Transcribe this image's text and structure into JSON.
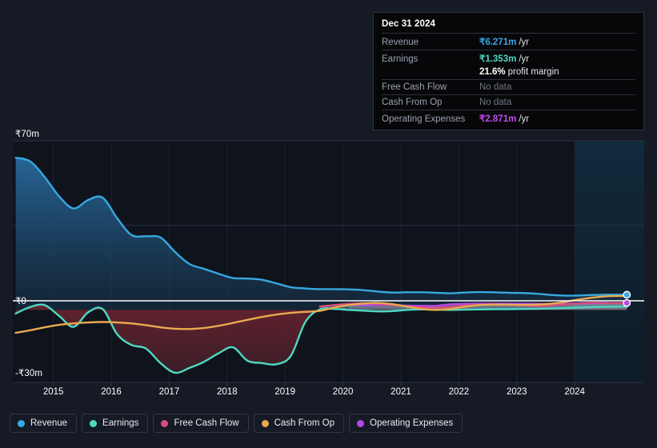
{
  "chart_data": {
    "type": "area",
    "title": "",
    "xlabel": "",
    "ylabel": "",
    "currency_symbol": "₹",
    "grid": true,
    "legend_position": "bottom-left",
    "ylim": [
      -30,
      70
    ],
    "y_ticks": [
      {
        "value": 70,
        "label": "₹70m"
      },
      {
        "value": 0,
        "label": "₹0"
      },
      {
        "value": -30,
        "label": "-₹30m"
      }
    ],
    "y_gridlines": [
      70,
      35,
      0,
      -30
    ],
    "x_ticks": [
      "2015",
      "2016",
      "2017",
      "2018",
      "2019",
      "2020",
      "2021",
      "2022",
      "2023",
      "2024"
    ],
    "xlim": [
      2014.3,
      2025.2
    ],
    "forecast_band_start": 2024.0,
    "series": [
      {
        "name": "Revenue",
        "color": "#38a8e0",
        "x": [
          2014.35,
          2014.6,
          2014.85,
          2015.1,
          2015.35,
          2015.6,
          2015.85,
          2016.1,
          2016.35,
          2016.6,
          2016.85,
          2017.1,
          2017.35,
          2017.6,
          2017.85,
          2018.1,
          2018.35,
          2018.6,
          2018.85,
          2019.1,
          2019.35,
          2019.6,
          2019.85,
          2020.1,
          2020.35,
          2020.6,
          2020.85,
          2021.1,
          2021.35,
          2021.6,
          2021.85,
          2022.1,
          2022.35,
          2022.6,
          2022.85,
          2023.1,
          2023.35,
          2023.6,
          2023.85,
          2024.1,
          2024.35,
          2024.6,
          2024.9
        ],
        "values": [
          63.0,
          61.5,
          55.0,
          47.0,
          42.0,
          45.5,
          46.5,
          38.0,
          31.0,
          30.5,
          30.0,
          24.0,
          19.0,
          17.0,
          15.0,
          13.2,
          13.0,
          12.5,
          11.0,
          9.4,
          8.9,
          8.6,
          8.6,
          8.5,
          8.2,
          7.6,
          7.2,
          7.3,
          7.3,
          7.1,
          6.9,
          7.2,
          7.4,
          7.3,
          7.1,
          7.0,
          6.7,
          6.2,
          5.9,
          6.0,
          6.2,
          6.3,
          6.271
        ]
      },
      {
        "name": "Earnings",
        "color": "#4fd8c2",
        "x": [
          2014.35,
          2014.6,
          2014.85,
          2015.1,
          2015.35,
          2015.6,
          2015.85,
          2016.1,
          2016.35,
          2016.6,
          2016.85,
          2017.1,
          2017.35,
          2017.6,
          2017.85,
          2018.1,
          2018.35,
          2018.6,
          2018.85,
          2019.1,
          2019.35,
          2019.6,
          2019.85,
          2020.1,
          2020.35,
          2020.6,
          2020.85,
          2021.1,
          2021.35,
          2021.6,
          2021.85,
          2022.1,
          2022.35,
          2022.6,
          2022.85,
          2023.1,
          2023.35,
          2023.6,
          2023.85,
          2024.1,
          2024.35,
          2024.6,
          2024.9
        ],
        "values": [
          -1.5,
          1.2,
          2.0,
          -2.5,
          -7.0,
          -1.0,
          0.4,
          -10.0,
          -14.5,
          -16.0,
          -22.0,
          -26.0,
          -24.0,
          -21.5,
          -18.0,
          -15.5,
          -21.0,
          -22.0,
          -22.5,
          -19.0,
          -5.0,
          0.2,
          0.4,
          0.0,
          -0.3,
          -0.6,
          -0.5,
          0.0,
          0.2,
          0.1,
          0.0,
          0.1,
          0.2,
          0.3,
          0.3,
          0.4,
          0.5,
          0.6,
          0.8,
          1.0,
          1.2,
          1.3,
          1.353
        ]
      },
      {
        "name": "Free Cash Flow",
        "color": "#d94f7f",
        "x": [
          2019.6,
          2019.85,
          2020.1,
          2020.35,
          2020.6,
          2020.85,
          2021.1,
          2021.35,
          2021.6,
          2021.85,
          2022.1,
          2022.35,
          2022.6,
          2022.85,
          2023.1,
          2023.35,
          2023.6,
          2023.85,
          2024.1,
          2024.35,
          2024.6,
          2024.9
        ],
        "values": [
          1.4,
          2.0,
          2.5,
          2.8,
          2.6,
          2.0,
          1.5,
          1.1,
          0.9,
          1.3,
          1.8,
          2.2,
          2.3,
          2.1,
          1.9,
          1.6,
          1.8,
          2.3,
          2.8,
          3.0,
          2.9,
          2.8
        ]
      },
      {
        "name": "Cash From Op",
        "color": "#eaa94f",
        "x": [
          2014.35,
          2014.6,
          2014.85,
          2015.1,
          2015.35,
          2015.6,
          2015.85,
          2016.1,
          2016.35,
          2016.6,
          2016.85,
          2017.1,
          2017.35,
          2017.6,
          2017.85,
          2018.1,
          2018.35,
          2018.6,
          2018.85,
          2019.1,
          2019.35,
          2019.6,
          2019.85,
          2020.1,
          2020.35,
          2020.6,
          2020.85,
          2021.1,
          2021.35,
          2021.6,
          2021.85,
          2022.1,
          2022.35,
          2022.6,
          2022.85,
          2023.1,
          2023.35,
          2023.6,
          2023.85,
          2024.1,
          2024.35,
          2024.6,
          2024.9
        ],
        "values": [
          -9.5,
          -8.4,
          -7.2,
          -6.2,
          -5.6,
          -5.2,
          -5.0,
          -5.2,
          -5.6,
          -6.3,
          -7.2,
          -7.8,
          -7.9,
          -7.5,
          -6.6,
          -5.4,
          -4.1,
          -2.9,
          -1.9,
          -1.2,
          -0.8,
          -0.4,
          1.0,
          2.0,
          2.6,
          2.9,
          2.4,
          1.4,
          0.4,
          0.0,
          0.4,
          1.3,
          2.0,
          2.2,
          2.2,
          2.1,
          2.2,
          2.6,
          3.4,
          4.4,
          5.2,
          5.7,
          5.8
        ]
      },
      {
        "name": "Operating Expenses",
        "color": "#b548e8",
        "x": [
          2020.1,
          2020.35,
          2020.6,
          2020.85,
          2021.1,
          2021.35,
          2021.6,
          2021.85,
          2022.1,
          2022.35,
          2022.6,
          2022.85,
          2023.1,
          2023.35,
          2023.6,
          2023.85,
          2024.1,
          2024.35,
          2024.6,
          2024.9
        ],
        "values": [
          2.0,
          2.0,
          2.0,
          2.0,
          1.8,
          1.7,
          1.7,
          2.3,
          2.5,
          2.6,
          2.6,
          2.6,
          2.6,
          2.5,
          2.5,
          2.6,
          2.75,
          2.85,
          2.87,
          2.871
        ]
      }
    ]
  },
  "tooltip": {
    "date": "Dec 31 2024",
    "rows": [
      {
        "name": "Revenue",
        "value": "₹6.271m",
        "suffix": "/yr",
        "color": "#38a8e0",
        "no_data": false
      },
      {
        "name": "Earnings",
        "value": "₹1.353m",
        "suffix": "/yr",
        "color": "#4fd8c2",
        "no_data": false
      },
      {
        "name": "",
        "value": "21.6%",
        "suffix": "profit margin",
        "color": "#ffffff",
        "no_data": false
      },
      {
        "name": "Free Cash Flow",
        "value": "No data",
        "suffix": "",
        "color": "#6d7582",
        "no_data": true
      },
      {
        "name": "Cash From Op",
        "value": "No data",
        "suffix": "",
        "color": "#6d7582",
        "no_data": true
      },
      {
        "name": "Operating Expenses",
        "value": "₹2.871m",
        "suffix": "/yr",
        "color": "#c44bf0",
        "no_data": false
      }
    ]
  },
  "legend": {
    "items": [
      {
        "label": "Revenue",
        "color": "#38a8e0"
      },
      {
        "label": "Earnings",
        "color": "#4fd8c2"
      },
      {
        "label": "Free Cash Flow",
        "color": "#d94f7f"
      },
      {
        "label": "Cash From Op",
        "color": "#eaa94f"
      },
      {
        "label": "Operating Expenses",
        "color": "#b548e8"
      }
    ]
  },
  "theme": {
    "background": "#151a24",
    "plot_background": "#0e131c",
    "gridline": "#2a3242",
    "zero_line": "#ffffff",
    "axis_text": "#ffffff"
  }
}
